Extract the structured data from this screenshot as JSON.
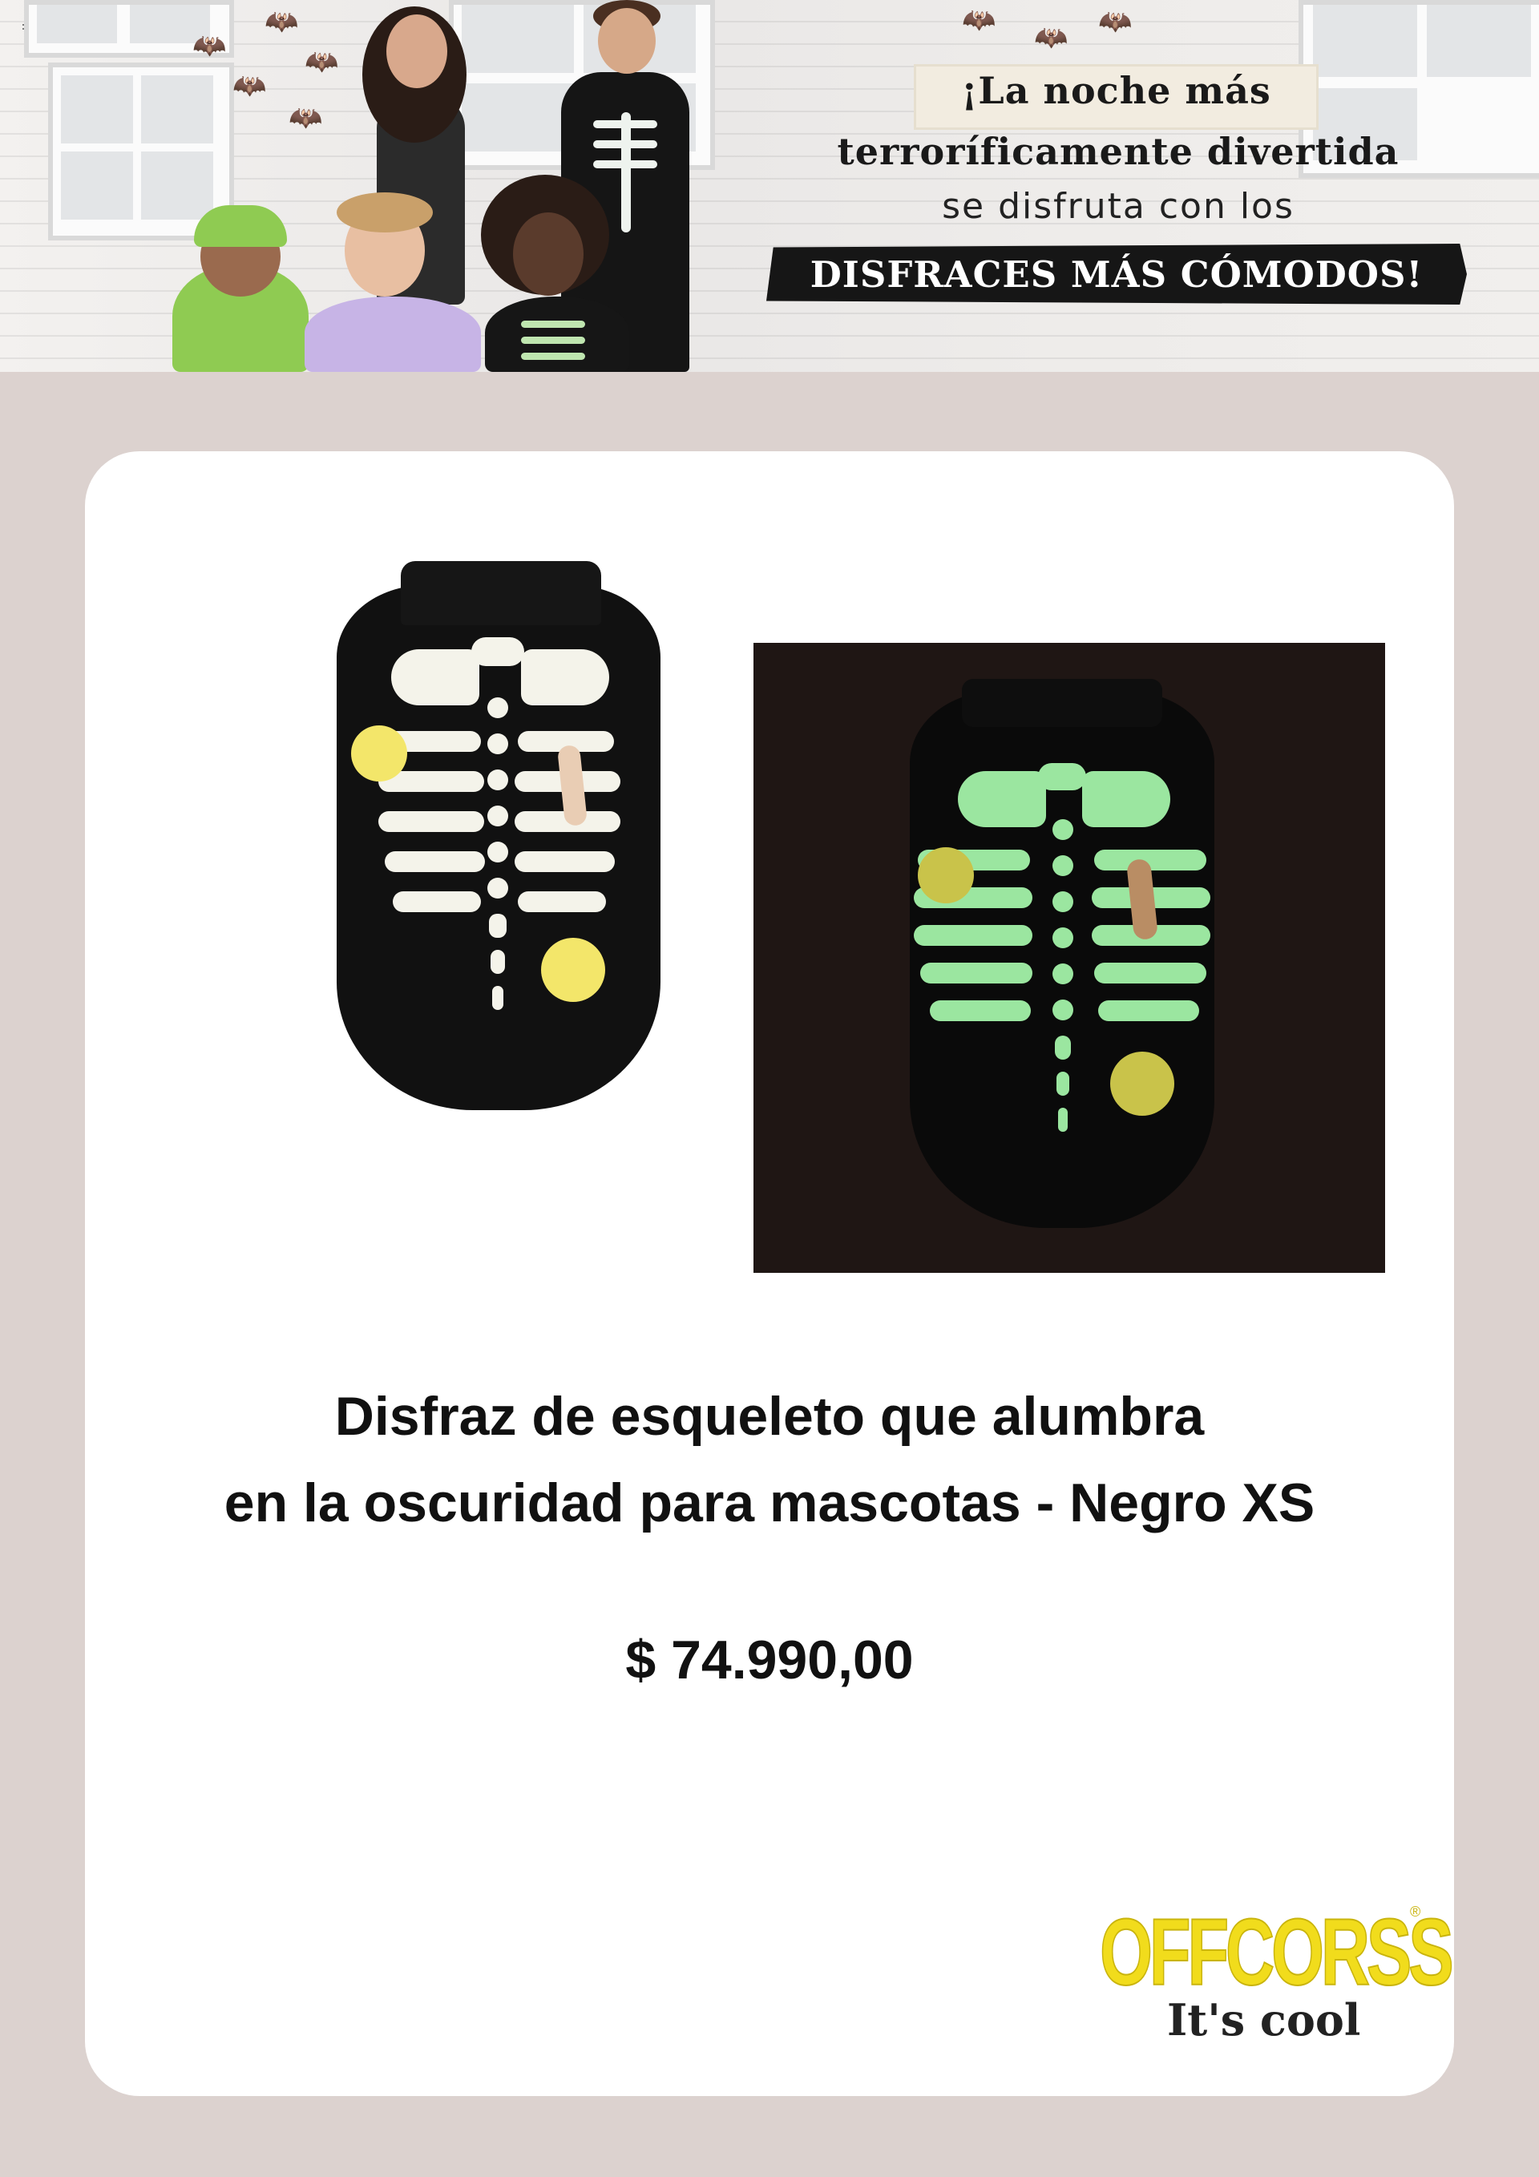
{
  "banner": {
    "headline_line1": "¡La noche más",
    "headline_line2": "terroríficamente divertida",
    "headline_line3": "se disfruta con los",
    "headline_line4": "DISFRACES MÁS CÓMODOS!"
  },
  "product": {
    "title_line1": "Disfraz de esqueleto que alumbra",
    "title_line2": "en la oscuridad para mascotas - Negro XS",
    "price": "$ 74.990,00",
    "image_day_alt": "skeleton-vest-photo",
    "image_night_alt": "skeleton-vest-glow-photo"
  },
  "brand": {
    "name": "OFFCORSS",
    "registered": "®",
    "tagline": "It's cool",
    "color": "#f1dc1c"
  },
  "colors": {
    "page_background": "#dcd2cf",
    "card_background": "#ffffff",
    "glow": "#9be6a0"
  }
}
